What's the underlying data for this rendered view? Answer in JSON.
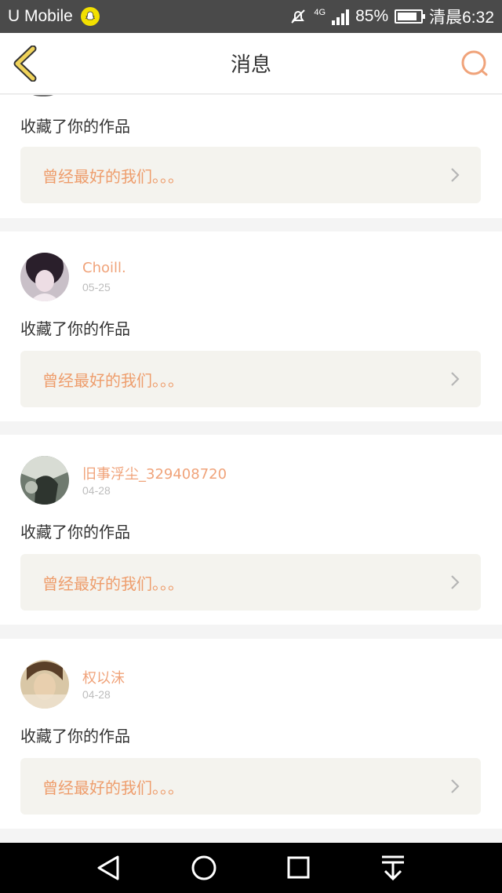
{
  "status_bar": {
    "carrier": "U Mobile",
    "network": "4G",
    "battery": "85%",
    "battery_level": 0.85,
    "time": "清晨6:32"
  },
  "header": {
    "title": "消息",
    "back_icon": "chevron-left-icon",
    "search_icon": "search-icon",
    "accent_color": "#f0a37a"
  },
  "notifications": [
    {
      "action": "收藏了你的作品",
      "work_title": "曾经最好的我们。。。"
    },
    {
      "username": "Choill.",
      "date": "05-25",
      "action": "收藏了你的作品",
      "work_title": "曾经最好的我们。。。"
    },
    {
      "username": "旧事浮尘_329408720",
      "date": "04-28",
      "action": "收藏了你的作品",
      "work_title": "曾经最好的我们。。。"
    },
    {
      "username": "权以沫",
      "date": "04-28",
      "action": "收藏了你的作品",
      "work_title": "曾经最好的我们。。。"
    }
  ],
  "system_nav": [
    "back-icon",
    "home-icon",
    "recents-icon",
    "notification-pulldown-icon"
  ]
}
